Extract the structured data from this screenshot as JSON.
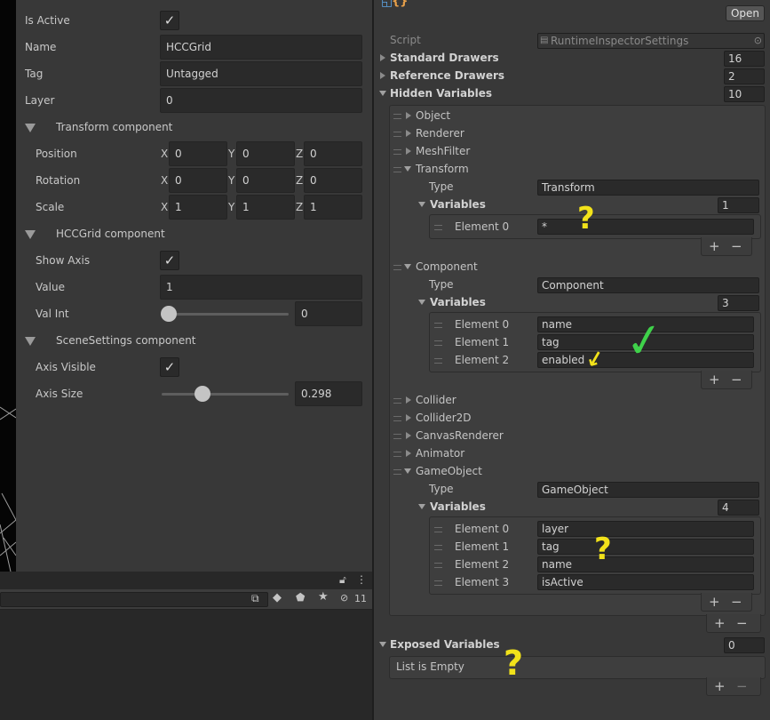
{
  "inspector": {
    "is_active_label": "Is Active",
    "name_label": "Name",
    "name_value": "HCCGrid",
    "tag_label": "Tag",
    "tag_value": "Untagged",
    "layer_label": "Layer",
    "layer_value": "0",
    "transform": {
      "header": "Transform component",
      "position_label": "Position",
      "rotation_label": "Rotation",
      "scale_label": "Scale",
      "axis_x": "X",
      "axis_y": "Y",
      "axis_z": "Z",
      "position": [
        "0",
        "0",
        "0"
      ],
      "rotation": [
        "0",
        "0",
        "0"
      ],
      "scale": [
        "1",
        "1",
        "1"
      ]
    },
    "hccgrid": {
      "header": "HCCGrid component",
      "show_axis_label": "Show Axis",
      "value_label": "Value",
      "value_value": "1",
      "val_int_label": "Val Int",
      "val_int_value": "0",
      "val_int_fraction": 0.0
    },
    "scene_settings": {
      "header": "SceneSettings component",
      "axis_visible_label": "Axis Visible",
      "axis_size_label": "Axis Size",
      "axis_size_value": "0.298",
      "axis_size_fraction": 0.3
    },
    "checkmark": "✓"
  },
  "bottom_toolbar": {
    "hidden_count": "11"
  },
  "settings": {
    "open_button": "Open",
    "script_label": "Script",
    "script_value": "RuntimeInspectorSettings",
    "standard_drawers_label": "Standard Drawers",
    "standard_drawers_count": "16",
    "reference_drawers_label": "Reference Drawers",
    "reference_drawers_count": "2",
    "hidden_variables_label": "Hidden Variables",
    "hidden_variables_count": "10",
    "type_label": "Type",
    "variables_label": "Variables",
    "plus": "+",
    "minus": "−",
    "collapsed_items": {
      "object": "Object",
      "renderer": "Renderer",
      "meshfilter": "MeshFilter",
      "collider": "Collider",
      "collider2d": "Collider2D",
      "canvasrenderer": "CanvasRenderer",
      "animator": "Animator"
    },
    "transform_item": {
      "label": "Transform",
      "type": "Transform",
      "variables_count": "1",
      "elements": [
        {
          "label": "Element 0",
          "value": "*"
        }
      ]
    },
    "component_item": {
      "label": "Component",
      "type": "Component",
      "variables_count": "3",
      "elements": [
        {
          "label": "Element 0",
          "value": "name"
        },
        {
          "label": "Element 1",
          "value": "tag"
        },
        {
          "label": "Element 2",
          "value": "enabled"
        }
      ]
    },
    "gameobject_item": {
      "label": "GameObject",
      "type": "GameObject",
      "variables_count": "4",
      "elements": [
        {
          "label": "Element 0",
          "value": "layer"
        },
        {
          "label": "Element 1",
          "value": "tag"
        },
        {
          "label": "Element 2",
          "value": "name"
        },
        {
          "label": "Element 3",
          "value": "isActive"
        }
      ]
    },
    "exposed_variables_label": "Exposed Variables",
    "exposed_variables_count": "0",
    "list_empty": "List is Empty"
  },
  "annotations": {
    "question": "?",
    "check": "✓",
    "arrow": "↙",
    "color": "#f2e21a",
    "check_color": "#3fd14a"
  }
}
